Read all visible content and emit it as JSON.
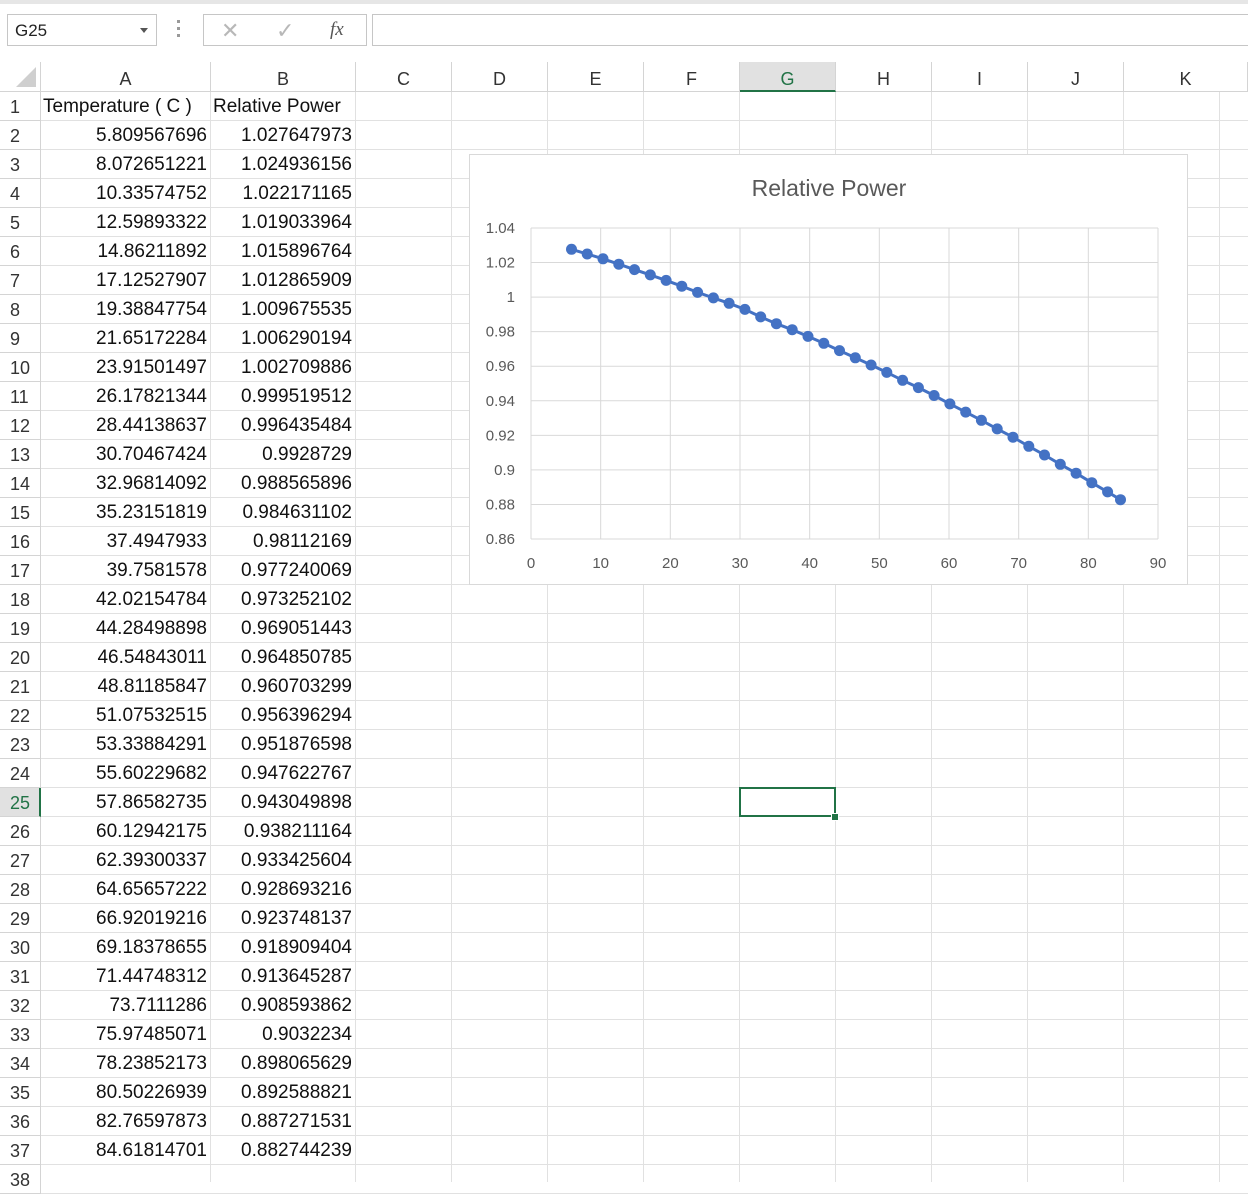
{
  "namebox": {
    "value": "G25"
  },
  "formula_bar": {
    "fx_label": "fx",
    "cancel_glyph": "✕",
    "enter_glyph": "✓",
    "content": ""
  },
  "columns": [
    "A",
    "B",
    "C",
    "D",
    "E",
    "F",
    "G",
    "H",
    "I",
    "J",
    "K"
  ],
  "selected_column": "G",
  "selected_row": "25",
  "rows": [
    "1",
    "2",
    "3",
    "4",
    "5",
    "6",
    "7",
    "8",
    "9",
    "10",
    "11",
    "12",
    "13",
    "14",
    "15",
    "16",
    "17",
    "18",
    "19",
    "20",
    "21",
    "22",
    "23",
    "24",
    "25",
    "26",
    "27",
    "28",
    "29",
    "30",
    "31",
    "32",
    "33",
    "34",
    "35",
    "36",
    "37",
    "38"
  ],
  "header_row": {
    "a": "Temperature ( C )",
    "b": "Relative Power"
  },
  "data_rows": [
    {
      "a": "5.809567696",
      "b": "1.027647973"
    },
    {
      "a": "8.072651221",
      "b": "1.024936156"
    },
    {
      "a": "10.33574752",
      "b": "1.022171165"
    },
    {
      "a": "12.59893322",
      "b": "1.019033964"
    },
    {
      "a": "14.86211892",
      "b": "1.015896764"
    },
    {
      "a": "17.12527907",
      "b": "1.012865909"
    },
    {
      "a": "19.38847754",
      "b": "1.009675535"
    },
    {
      "a": "21.65172284",
      "b": "1.006290194"
    },
    {
      "a": "23.91501497",
      "b": "1.002709886"
    },
    {
      "a": "26.17821344",
      "b": "0.999519512"
    },
    {
      "a": "28.44138637",
      "b": "0.996435484"
    },
    {
      "a": "30.70467424",
      "b": "0.9928729"
    },
    {
      "a": "32.96814092",
      "b": "0.988565896"
    },
    {
      "a": "35.23151819",
      "b": "0.984631102"
    },
    {
      "a": "37.4947933",
      "b": "0.98112169"
    },
    {
      "a": "39.7581578",
      "b": "0.977240069"
    },
    {
      "a": "42.02154784",
      "b": "0.973252102"
    },
    {
      "a": "44.28498898",
      "b": "0.969051443"
    },
    {
      "a": "46.54843011",
      "b": "0.964850785"
    },
    {
      "a": "48.81185847",
      "b": "0.960703299"
    },
    {
      "a": "51.07532515",
      "b": "0.956396294"
    },
    {
      "a": "53.33884291",
      "b": "0.951876598"
    },
    {
      "a": "55.60229682",
      "b": "0.947622767"
    },
    {
      "a": "57.86582735",
      "b": "0.943049898"
    },
    {
      "a": "60.12942175",
      "b": "0.938211164"
    },
    {
      "a": "62.39300337",
      "b": "0.933425604"
    },
    {
      "a": "64.65657222",
      "b": "0.928693216"
    },
    {
      "a": "66.92019216",
      "b": "0.923748137"
    },
    {
      "a": "69.18378655",
      "b": "0.918909404"
    },
    {
      "a": "71.44748312",
      "b": "0.913645287"
    },
    {
      "a": "73.7111286",
      "b": "0.908593862"
    },
    {
      "a": "75.97485071",
      "b": "0.9032234"
    },
    {
      "a": "78.23852173",
      "b": "0.898065629"
    },
    {
      "a": "80.50226939",
      "b": "0.892588821"
    },
    {
      "a": "82.76597873",
      "b": "0.887271531"
    },
    {
      "a": "84.61814701",
      "b": "0.882744239"
    }
  ],
  "chart_data": {
    "type": "scatter",
    "title": "Relative Power",
    "xlabel": "",
    "ylabel": "",
    "xlim": [
      0,
      90
    ],
    "ylim": [
      0.86,
      1.04
    ],
    "xticks": [
      "0",
      "10",
      "20",
      "30",
      "40",
      "50",
      "60",
      "70",
      "80",
      "90"
    ],
    "yticks": [
      "0.86",
      "0.88",
      "0.9",
      "0.92",
      "0.94",
      "0.96",
      "0.98",
      "1",
      "1.02",
      "1.04"
    ],
    "grid": true,
    "legend": "none",
    "line_color": "#4472c4",
    "marker": "circle",
    "series": [
      {
        "x": [
          5.809567696,
          8.072651221,
          10.33574752,
          12.59893322,
          14.86211892,
          17.12527907,
          19.38847754,
          21.65172284,
          23.91501497,
          26.17821344,
          28.44138637,
          30.70467424,
          32.96814092,
          35.23151819,
          37.4947933,
          39.7581578,
          42.02154784,
          44.28498898,
          46.54843011,
          48.81185847,
          51.07532515,
          53.33884291,
          55.60229682,
          57.86582735,
          60.12942175,
          62.39300337,
          64.65657222,
          66.92019216,
          69.18378655,
          71.44748312,
          73.7111286,
          75.97485071,
          78.23852173,
          80.50226939,
          82.76597873,
          84.61814701
        ],
        "y": [
          1.027647973,
          1.024936156,
          1.022171165,
          1.019033964,
          1.015896764,
          1.012865909,
          1.009675535,
          1.006290194,
          1.002709886,
          0.999519512,
          0.996435484,
          0.9928729,
          0.988565896,
          0.984631102,
          0.98112169,
          0.977240069,
          0.973252102,
          0.969051443,
          0.964850785,
          0.960703299,
          0.956396294,
          0.951876598,
          0.947622767,
          0.943049898,
          0.938211164,
          0.933425604,
          0.928693216,
          0.923748137,
          0.918909404,
          0.913645287,
          0.908593862,
          0.9032234,
          0.898065629,
          0.892588821,
          0.887271531,
          0.882744239
        ]
      }
    ]
  }
}
